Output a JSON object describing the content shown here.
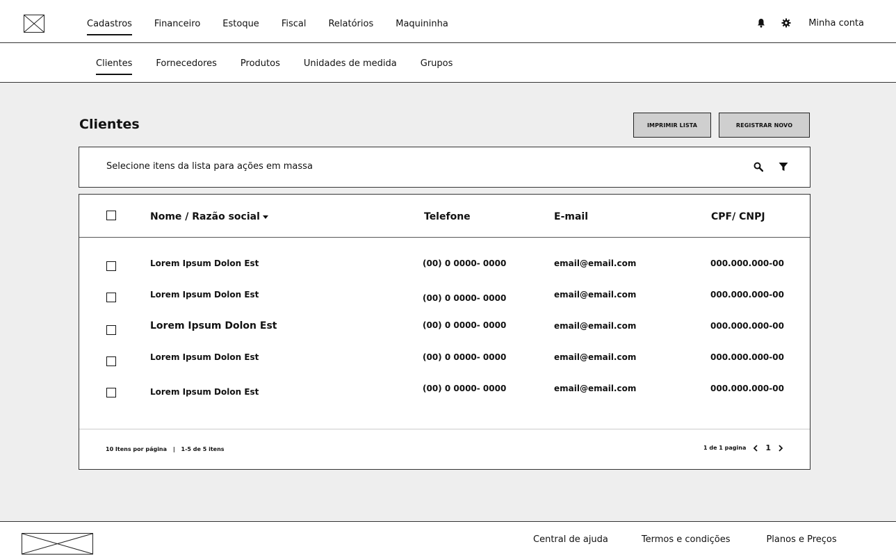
{
  "top_nav": {
    "items": [
      {
        "label": "Cadastros",
        "active": true
      },
      {
        "label": "Financeiro",
        "active": false
      },
      {
        "label": "Estoque",
        "active": false
      },
      {
        "label": "Fiscal",
        "active": false
      },
      {
        "label": "Relatórios",
        "active": false
      },
      {
        "label": "Maquininha",
        "active": false
      }
    ],
    "account_label": "Minha conta",
    "icons": [
      "bell-icon",
      "gear-icon"
    ]
  },
  "sub_nav": {
    "items": [
      {
        "label": "Clientes",
        "active": true
      },
      {
        "label": "Fornecedores",
        "active": false
      },
      {
        "label": "Produtos",
        "active": false
      },
      {
        "label": "Unidades de medida",
        "active": false
      },
      {
        "label": "Grupos",
        "active": false
      }
    ]
  },
  "page": {
    "title": "Clientes",
    "print_button": "IMPRIMIR LISTA",
    "new_button": "REGISTRAR NOVO",
    "bulk_text": "Selecione itens da lista para ações em massa",
    "bulk_icons": [
      "search-icon",
      "filter-icon"
    ]
  },
  "table": {
    "headers": {
      "name": "Nome / Razão social",
      "phone": "Telefone",
      "email": "E-mail",
      "doc": "CPF/ CNPJ"
    },
    "rows": [
      {
        "name": "Lorem Ipsum Dolon Est",
        "phone": "(00) 0 0000- 0000",
        "email": "email@email.com",
        "doc": "000.000.000-00"
      },
      {
        "name": "Lorem Ipsum Dolon Est",
        "phone": "(00) 0 0000- 0000",
        "email": "email@email.com",
        "doc": "000.000.000-00"
      },
      {
        "name": "Lorem Ipsum Dolon Est",
        "phone": "(00) 0 0000- 0000",
        "email": "email@email.com",
        "doc": "000.000.000-00"
      },
      {
        "name": "Lorem Ipsum Dolon Est",
        "phone": "(00) 0 0000- 0000",
        "email": "email@email.com",
        "doc": "000.000.000-00"
      },
      {
        "name": "Lorem Ipsum Dolon Est",
        "phone": "(00) 0 0000- 0000",
        "email": "email@email.com",
        "doc": "000.000.000-00"
      }
    ],
    "footer": {
      "per_page": "10 Itens por página",
      "separator": "|",
      "range": "1-5 de 5 itens",
      "page_info": "1 de 1 pagina",
      "current_page": "1"
    }
  },
  "footer": {
    "links": [
      "Central de ajuda",
      "Termos e condições",
      "Planos e Preços"
    ]
  },
  "colors": {
    "background": "#eeeeee",
    "button": "#cfcfcf",
    "border": "#333333"
  }
}
